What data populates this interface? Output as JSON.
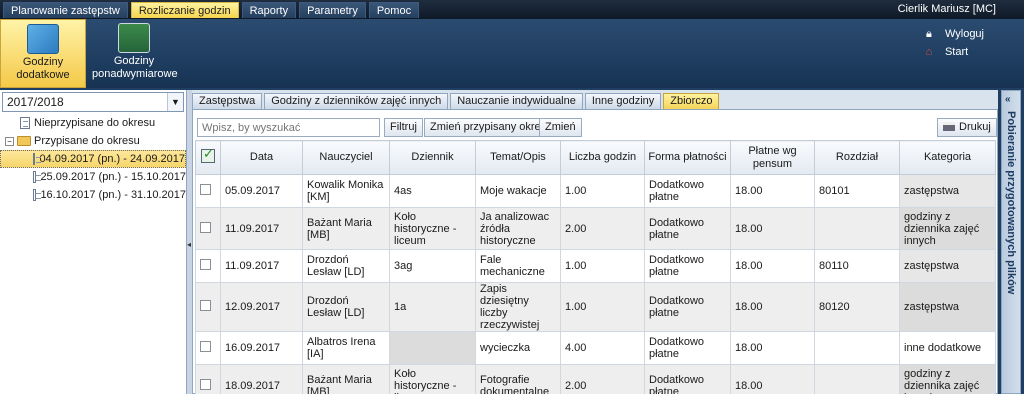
{
  "menu": {
    "items": [
      "Planowanie zastępstw",
      "Rozliczanie godzin",
      "Raporty",
      "Parametry",
      "Pomoc"
    ],
    "user": "Cierlik Mariusz [MC]"
  },
  "ribbon": {
    "btn1": "Godziny dodatkowe",
    "btn2": "Godziny ponadwymiarowe",
    "logout": "Wyloguj",
    "start": "Start"
  },
  "left": {
    "year": "2017/2018",
    "unassigned": "Nieprzypisane do okresu",
    "assigned": "Przypisane do okresu",
    "periods": [
      "04.09.2017 (pn.) - 24.09.2017",
      "25.09.2017 (pn.) - 15.10.2017",
      "16.10.2017 (pn.) - 31.10.2017"
    ]
  },
  "tabs": [
    "Zastępstwa",
    "Godziny z dzienników zajęć innych",
    "Nauczanie indywidualne",
    "Inne godziny",
    "Zbiorczo"
  ],
  "toolbar": {
    "search_placeholder": "Wpisz, by wyszukać",
    "filter": "Filtruj",
    "change_period": "Zmień przypisany okres",
    "change": "Zmień",
    "print": "Drukuj"
  },
  "columns": [
    "Data",
    "Nauczyciel",
    "Dziennik",
    "Temat/Opis",
    "Liczba godzin",
    "Forma płatności",
    "Płatne wg pensum",
    "Rozdział",
    "Kategoria"
  ],
  "rows": [
    {
      "date": "05.09.2017",
      "teacher": "Kowalik Monika [KM]",
      "journal": "4as",
      "topic": "Moje wakacje",
      "hours": "1.00",
      "payment": "Dodatkowo płatne",
      "pensum": "18.00",
      "chapter": "80101",
      "category": "zastępstwa"
    },
    {
      "date": "11.09.2017",
      "teacher": "Bażant Maria [MB]",
      "journal": "Koło historyczne - liceum",
      "topic": "Ja analizowac źródła historyczne",
      "hours": "2.00",
      "payment": "Dodatkowo płatne",
      "pensum": "18.00",
      "chapter": "",
      "category": "godziny z dziennika zajęć innych"
    },
    {
      "date": "11.09.2017",
      "teacher": "Drozdoń Lesław [LD]",
      "journal": "3ag",
      "topic": "Fale mechaniczne",
      "hours": "1.00",
      "payment": "Dodatkowo płatne",
      "pensum": "18.00",
      "chapter": "80110",
      "category": "zastępstwa"
    },
    {
      "date": "12.09.2017",
      "teacher": "Drozdoń Lesław [LD]",
      "journal": "1a",
      "topic": "Zapis dziesiętny liczby rzeczywistej",
      "hours": "1.00",
      "payment": "Dodatkowo płatne",
      "pensum": "18.00",
      "chapter": "80120",
      "category": "zastępstwa"
    },
    {
      "date": "16.09.2017",
      "teacher": "Albatros Irena [IA]",
      "journal": "",
      "topic": "wycieczka",
      "hours": "4.00",
      "payment": "Dodatkowo płatne",
      "pensum": "18.00",
      "chapter": "",
      "category": "inne dodatkowe"
    },
    {
      "date": "18.09.2017",
      "teacher": "Bażant Maria [MB]",
      "journal": "Koło historyczne - liceum",
      "topic": "Fotografie dokumentalne",
      "hours": "2.00",
      "payment": "Dodatkowo płatne",
      "pensum": "18.00",
      "chapter": "",
      "category": "godziny z dziennika zajęć innych"
    }
  ],
  "right_panel": {
    "label": "Pobieranie przygotowanych plików"
  }
}
